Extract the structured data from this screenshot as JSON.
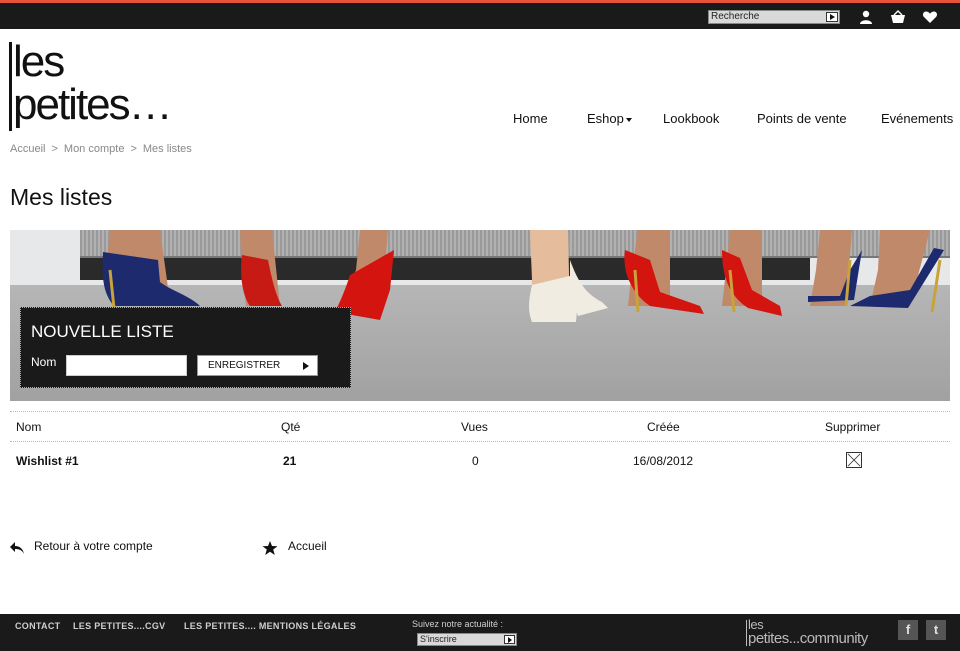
{
  "colors": {
    "accent": "#e8533a",
    "topbar": "#1a1a1a"
  },
  "header": {
    "search_placeholder": "Recherche",
    "icons": [
      "user-icon",
      "basket-icon",
      "heart-icon"
    ],
    "logo_line1": "les",
    "logo_line2": "petites…"
  },
  "nav": {
    "home": "Home",
    "eshop": "Eshop",
    "lookbook": "Lookbook",
    "points_de_vente": "Points de vente",
    "evenements": "Evénements"
  },
  "breadcrumb": {
    "items": [
      "Accueil",
      "Mon compte",
      "Mes listes"
    ],
    "separator": ">"
  },
  "page_title": "Mes listes",
  "new_list": {
    "title": "NOUVELLE LISTE",
    "name_label": "Nom",
    "name_value": "",
    "save_label": "ENREGISTRER"
  },
  "table": {
    "headers": [
      "Nom",
      "Qté",
      "Vues",
      "Créée",
      "Supprimer"
    ],
    "rows": [
      {
        "name": "Wishlist #1",
        "qty": "21",
        "views": "0",
        "created": "16/08/2012"
      }
    ]
  },
  "bottom_links": {
    "back_to_account": "Retour à votre compte",
    "home": "Accueil"
  },
  "footer": {
    "links": [
      "CONTACT",
      "LES PETITES....CGV",
      "LES PETITES.... MENTIONS LÉGALES"
    ],
    "follow_label": "Suivez notre actualité :",
    "subscribe_placeholder": "S'inscrire",
    "community_line1": "les",
    "community_line2": "petites...community",
    "social": [
      "f",
      "t"
    ]
  }
}
